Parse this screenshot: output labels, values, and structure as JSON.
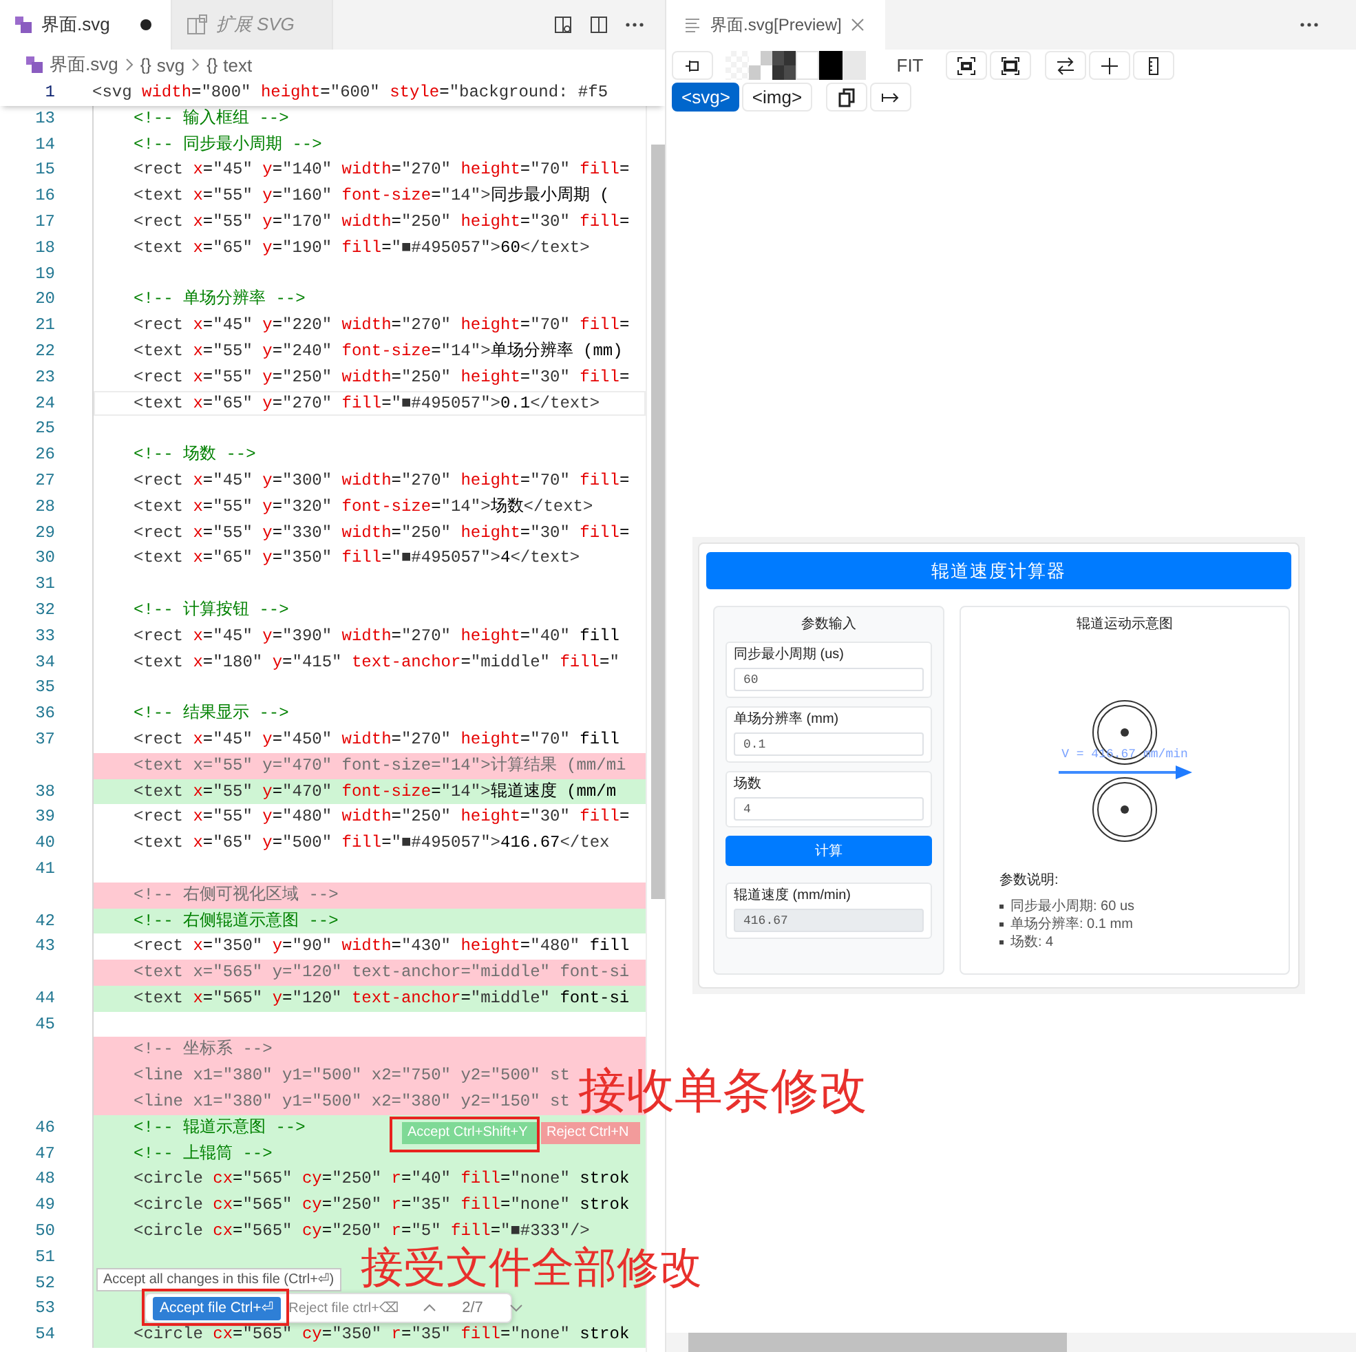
{
  "editor": {
    "tabs": [
      {
        "label": "界面.svg",
        "selected": true,
        "dirty": true,
        "preview": false
      },
      {
        "label": "扩展 SVG",
        "selected": false,
        "dirty": false,
        "preview": true
      }
    ],
    "breadcrumb": [
      {
        "kind": "file",
        "label": "界面.svg"
      },
      {
        "kind": "symbol",
        "symbol": "{}",
        "label": "svg"
      },
      {
        "kind": "symbol",
        "symbol": "{}",
        "label": "text"
      }
    ],
    "sticky_line": {
      "number": "1",
      "code": "<svg width=\"800\" height=\"600\" style=\"background: #f5"
    },
    "lines": [
      {
        "number": "13",
        "added": false,
        "removed": false,
        "current": false,
        "code": "<!-- 输入框组 -->"
      },
      {
        "number": "14",
        "added": false,
        "removed": false,
        "current": false,
        "code": "<!-- 同步最小周期 -->"
      },
      {
        "number": "15",
        "added": false,
        "removed": false,
        "current": false,
        "code": "<rect x=\"45\" y=\"140\" width=\"270\" height=\"70\" fill="
      },
      {
        "number": "16",
        "added": false,
        "removed": false,
        "current": false,
        "code": "<text x=\"55\" y=\"160\" font-size=\"14\">同步最小周期 ("
      },
      {
        "number": "17",
        "added": false,
        "removed": false,
        "current": false,
        "code": "<rect x=\"55\" y=\"170\" width=\"250\" height=\"30\" fill="
      },
      {
        "number": "18",
        "added": false,
        "removed": false,
        "current": false,
        "code": "<text x=\"65\" y=\"190\" fill=\"■#495057\">60</text>"
      },
      {
        "number": "19",
        "added": false,
        "removed": false,
        "current": false
      },
      {
        "number": "20",
        "added": false,
        "removed": false,
        "current": false,
        "code": "<!-- 单场分辨率 -->"
      },
      {
        "number": "21",
        "added": false,
        "removed": false,
        "current": false,
        "code": "<rect x=\"45\" y=\"220\" width=\"270\" height=\"70\" fill="
      },
      {
        "number": "22",
        "added": false,
        "removed": false,
        "current": false,
        "code": "<text x=\"55\" y=\"240\" font-size=\"14\">单场分辨率 (mm)"
      },
      {
        "number": "23",
        "added": false,
        "removed": false,
        "current": false,
        "code": "<rect x=\"55\" y=\"250\" width=\"250\" height=\"30\" fill="
      },
      {
        "number": "24",
        "added": false,
        "removed": false,
        "current": true,
        "code": "<text x=\"65\" y=\"270\" fill=\"■#495057\">0.1</text>"
      },
      {
        "number": "25",
        "added": false,
        "removed": false,
        "current": false
      },
      {
        "number": "26",
        "added": false,
        "removed": false,
        "current": false,
        "code": "<!-- 场数 -->"
      },
      {
        "number": "27",
        "added": false,
        "removed": false,
        "current": false,
        "code": "<rect x=\"45\" y=\"300\" width=\"270\" height=\"70\" fill="
      },
      {
        "number": "28",
        "added": false,
        "removed": false,
        "current": false,
        "code": "<text x=\"55\" y=\"320\" font-size=\"14\">场数</text>"
      },
      {
        "number": "29",
        "added": false,
        "removed": false,
        "current": false,
        "code": "<rect x=\"55\" y=\"330\" width=\"250\" height=\"30\" fill="
      },
      {
        "number": "30",
        "added": false,
        "removed": false,
        "current": false,
        "code": "<text x=\"65\" y=\"350\" fill=\"■#495057\">4</text>"
      },
      {
        "number": "31",
        "added": false,
        "removed": false,
        "current": false
      },
      {
        "number": "32",
        "added": false,
        "removed": false,
        "current": false,
        "code": "<!-- 计算按钮 -->"
      },
      {
        "number": "33",
        "added": false,
        "removed": false,
        "current": false,
        "code": "<rect x=\"45\" y=\"390\" width=\"270\" height=\"40\" fill"
      },
      {
        "number": "34",
        "added": false,
        "removed": false,
        "current": false,
        "code": "<text x=\"180\" y=\"415\" text-anchor=\"middle\" fill=\""
      },
      {
        "number": "35",
        "added": false,
        "removed": false,
        "current": false
      },
      {
        "number": "36",
        "added": false,
        "removed": false,
        "current": false,
        "code": "<!-- 结果显示 -->"
      },
      {
        "number": "37",
        "added": false,
        "removed": false,
        "current": false,
        "code": "<rect x=\"45\" y=\"450\" width=\"270\" height=\"70\" fill"
      },
      {
        "added": false,
        "removed": true,
        "current": false,
        "code": "<text x=\"55\" y=\"470\" font-size=\"14\">计算结果 (mm/mi"
      },
      {
        "number": "38",
        "added": true,
        "removed": false,
        "current": false,
        "code": "<text x=\"55\" y=\"470\" font-size=\"14\">辊道速度 (mm/m"
      },
      {
        "number": "39",
        "added": false,
        "removed": false,
        "current": false,
        "code": "<rect x=\"55\" y=\"480\" width=\"250\" height=\"30\" fill="
      },
      {
        "number": "40",
        "added": false,
        "removed": false,
        "current": false,
        "code": "<text x=\"65\" y=\"500\" fill=\"■#495057\">416.67</tex"
      },
      {
        "number": "41",
        "added": false,
        "removed": false,
        "current": false
      },
      {
        "added": false,
        "removed": true,
        "current": false,
        "code": "<!-- 右侧可视化区域 -->"
      },
      {
        "number": "42",
        "added": true,
        "removed": false,
        "current": false,
        "code": "<!-- 右侧辊道示意图 -->"
      },
      {
        "number": "43",
        "added": false,
        "removed": false,
        "current": false,
        "code": "<rect x=\"350\" y=\"90\" width=\"430\" height=\"480\" fill"
      },
      {
        "added": false,
        "removed": true,
        "current": false,
        "code": "<text x=\"565\" y=\"120\" text-anchor=\"middle\" font-si"
      },
      {
        "number": "44",
        "added": true,
        "removed": false,
        "current": false,
        "code": "<text x=\"565\" y=\"120\" text-anchor=\"middle\" font-si"
      },
      {
        "number": "45",
        "added": false,
        "removed": false,
        "current": false
      },
      {
        "added": false,
        "removed": true,
        "current": false,
        "code": "<!-- 坐标系 -->"
      },
      {
        "added": false,
        "removed": true,
        "current": false,
        "code": "<line x1=\"380\" y1=\"500\" x2=\"750\" y2=\"500\" st"
      },
      {
        "added": false,
        "removed": true,
        "current": false,
        "code": "<line x1=\"380\" y1=\"500\" x2=\"380\" y2=\"150\" st"
      },
      {
        "number": "46",
        "added": true,
        "removed": false,
        "current": false,
        "code": "<!-- 辊道示意图 -->"
      },
      {
        "number": "47",
        "added": true,
        "removed": false,
        "current": false,
        "code": "<!-- 上辊筒 -->"
      },
      {
        "number": "48",
        "added": true,
        "removed": false,
        "current": false,
        "code": "<circle cx=\"565\" cy=\"250\" r=\"40\" fill=\"none\" strok"
      },
      {
        "number": "49",
        "added": true,
        "removed": false,
        "current": false,
        "code": "<circle cx=\"565\" cy=\"250\" r=\"35\" fill=\"none\" strok"
      },
      {
        "number": "50",
        "added": true,
        "removed": false,
        "current": false,
        "code": "<circle cx=\"565\" cy=\"250\" r=\"5\" fill=\"■#333\"/>"
      },
      {
        "number": "51",
        "added": true,
        "removed": false,
        "current": false
      },
      {
        "number": "52",
        "added": true,
        "removed": false,
        "current": false
      },
      {
        "number": "53",
        "added": true,
        "removed": false,
        "current": false
      },
      {
        "number": "54",
        "added": true,
        "removed": false,
        "current": false,
        "code": "<circle cx=\"565\" cy=\"350\" r=\"35\" fill=\"none\" strok"
      }
    ],
    "inline_actions": [
      {
        "kind": "accept",
        "label": "Accept Ctrl+Shift+Y"
      },
      {
        "kind": "reject",
        "label": "Reject Ctrl+N"
      }
    ],
    "tooltip": "Accept all changes in this file (Ctrl+⏎)",
    "review_bar": {
      "accept": "Accept file Ctrl+⏎",
      "reject": "Reject file ctrl+⌫",
      "position": "2/7"
    },
    "annotations": [
      {
        "text": "接收单条修改"
      },
      {
        "text": "接受文件全部修改"
      }
    ]
  },
  "preview": {
    "tab": {
      "label": "界面.svg[Preview]"
    },
    "swatches": [
      {
        "kind": "transparent"
      },
      {
        "kind": "checker-light"
      },
      {
        "kind": "checker-dark"
      },
      {
        "kind": "white"
      },
      {
        "kind": "black"
      },
      {
        "kind": "light-gray"
      }
    ],
    "fit_label": "FIT",
    "modes": [
      {
        "label": "<svg>",
        "selected": true
      },
      {
        "label": "<img>",
        "selected": false
      }
    ],
    "document": {
      "title": "辊道速度计算器",
      "input_panel": {
        "title": "参数输入",
        "fields": [
          {
            "label": "同步最小周期 (us)",
            "value": "60",
            "readonly": false
          },
          {
            "label": "单场分辨率 (mm)",
            "value": "0.1",
            "readonly": false
          },
          {
            "label": "场数",
            "value": "4",
            "readonly": false
          }
        ],
        "button": "计算",
        "result": {
          "label": "辊道速度 (mm/min)",
          "value": "416.67",
          "readonly": true
        }
      },
      "diagram_panel": {
        "title": "辊道运动示意图",
        "velocity_label": "V = 416.67 mm/min",
        "notes_title": "参数说明:",
        "notes": [
          "同步最小周期: 60 us",
          "单场分辨率: 0.1 mm",
          "场数: 4"
        ]
      }
    }
  }
}
